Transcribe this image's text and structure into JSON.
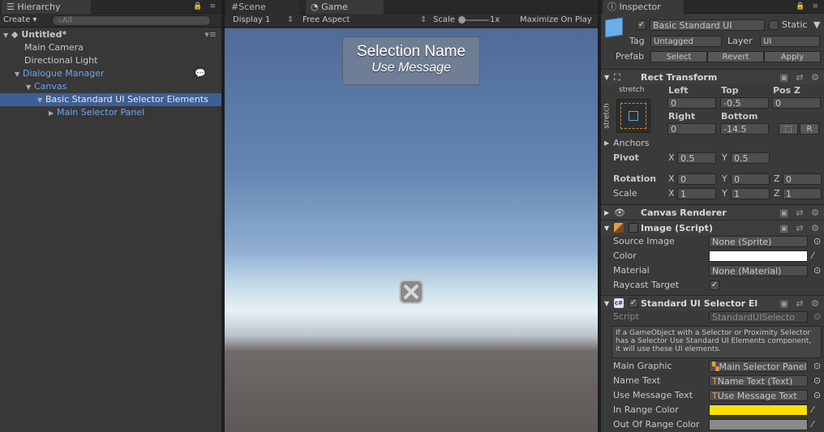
{
  "hierarchy": {
    "tab_label": "Hierarchy",
    "create_label": "Create",
    "search_placeholder": "All",
    "scene_name": "Untitled*",
    "items": [
      {
        "label": "Main Camera"
      },
      {
        "label": "Directional Light"
      },
      {
        "label": "Dialogue Manager"
      },
      {
        "label": "Canvas"
      },
      {
        "label": "Basic Standard UI Selector Elements"
      },
      {
        "label": "Main Selector Panel"
      }
    ]
  },
  "game": {
    "tabs": [
      {
        "label": "Scene"
      },
      {
        "label": "Game"
      }
    ],
    "display": "Display 1",
    "aspect": "Free Aspect",
    "scale_label": "Scale",
    "scale_value": "1x",
    "maximize_label": "Maximize On Play",
    "selection_name": "Selection Name",
    "use_message": "Use Message"
  },
  "inspector": {
    "tab_label": "Inspector",
    "object_name": "Basic Standard UI",
    "static_label": "Static",
    "tag_label": "Tag",
    "tag_value": "Untagged",
    "layer_label": "Layer",
    "layer_value": "UI",
    "prefab_label": "Prefab",
    "prefab_select": "Select",
    "prefab_revert": "Revert",
    "prefab_apply": "Apply",
    "rect_transform": {
      "title": "Rect Transform",
      "stretch_top": "stretch",
      "stretch_side": "stretch",
      "left_label": "Left",
      "left": "0",
      "top_label": "Top",
      "top": "-0.5",
      "posz_label": "Pos Z",
      "posz": "0",
      "right_label": "Right",
      "right": "0",
      "bottom_label": "Bottom",
      "bottom": "-14.5",
      "r_btn": "R",
      "anchors_label": "Anchors",
      "pivot_label": "Pivot",
      "pivot_x": "0.5",
      "pivot_y": "0.5",
      "rotation_label": "Rotation",
      "rot_x": "0",
      "rot_y": "0",
      "rot_z": "0",
      "scale_label": "Scale",
      "scale_x": "1",
      "scale_y": "1",
      "scale_z": "1",
      "x": "X",
      "y": "Y",
      "z": "Z"
    },
    "canvas_renderer": {
      "title": "Canvas Renderer"
    },
    "image_script": {
      "title": "Image (Script)",
      "source_image_label": "Source Image",
      "source_image": "None (Sprite)",
      "color_label": "Color",
      "color": "#ffffff",
      "material_label": "Material",
      "material": "None (Material)",
      "raycast_label": "Raycast Target"
    },
    "selector_elements": {
      "title": "Standard UI Selector El",
      "script_label": "Script",
      "script": "StandardUISelecto",
      "help": "If a GameObject with a Selector or Proximity Selector has a Selector Use Standard UI Elements component, it will use these UI elements.",
      "main_graphic_label": "Main Graphic",
      "main_graphic": "Main Selector Panel",
      "name_text_label": "Name Text",
      "name_text": "Name Text (Text)",
      "use_message_label": "Use Message Text",
      "use_message": "Use Message Text",
      "in_range_label": "In Range Color",
      "in_range_color": "#ffe000",
      "out_range_label": "Out Of Range Color",
      "out_range_color": "#8a8a8a"
    }
  }
}
